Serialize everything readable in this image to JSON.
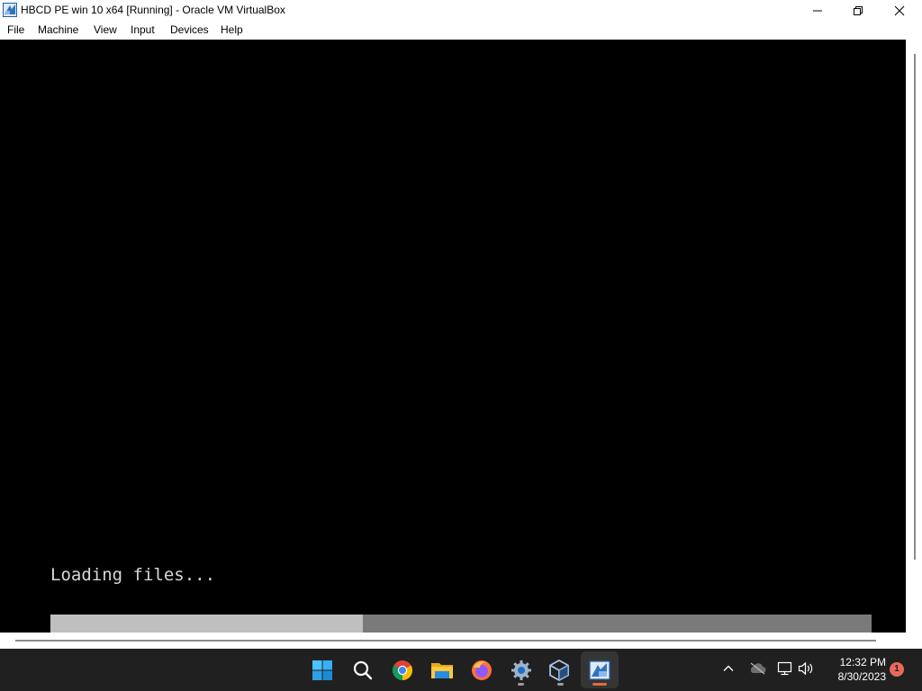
{
  "window": {
    "title": "HBCD PE win 10 x64 [Running] - Oracle VM VirtualBox",
    "icon": "virtualbox-icon",
    "controls": [
      "minimize-icon",
      "restore-icon",
      "close-icon"
    ]
  },
  "menu": {
    "items": [
      "File",
      "Machine",
      "View",
      "Input",
      "Devices",
      "Help"
    ]
  },
  "vm": {
    "loading_text": "Loading files...",
    "progress_fraction": 0.38,
    "colors": {
      "background": "#000000",
      "text": "#d8d8d8",
      "progress_filled": "#bfbfbf",
      "progress_track": "#7a7a7a"
    }
  },
  "taskbar": {
    "apps": [
      {
        "name": "start-icon",
        "running": false,
        "active": false
      },
      {
        "name": "search-icon",
        "running": false,
        "active": false
      },
      {
        "name": "chrome-icon",
        "running": false,
        "active": false
      },
      {
        "name": "file-explorer-icon",
        "running": false,
        "active": false
      },
      {
        "name": "firefox-icon",
        "running": false,
        "active": false
      },
      {
        "name": "settings-icon",
        "running": true,
        "active": false
      },
      {
        "name": "virtualbox-manager-icon",
        "running": true,
        "active": false
      },
      {
        "name": "virtualbox-vm-icon",
        "running": true,
        "active": true
      }
    ],
    "tray": [
      "chevron-up-icon",
      "onedrive-icon",
      "network-icon",
      "volume-icon"
    ],
    "time": "12:32 PM",
    "date": "8/30/2023",
    "notification_count": "1",
    "colors": {
      "background": "#202020",
      "accent_running": "#e06c3a",
      "badge": "#e86a5c"
    }
  }
}
